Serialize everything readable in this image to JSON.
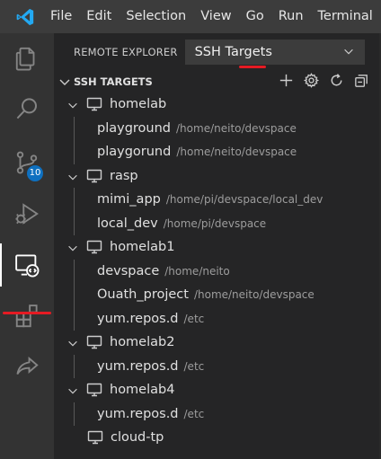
{
  "menubar": {
    "items": [
      "File",
      "Edit",
      "Selection",
      "View",
      "Go",
      "Run",
      "Terminal"
    ]
  },
  "activitybar": {
    "items": [
      {
        "name": "explorer-icon"
      },
      {
        "name": "search-icon"
      },
      {
        "name": "source-control-icon",
        "badge": "10"
      },
      {
        "name": "run-debug-icon"
      },
      {
        "name": "remote-explorer-icon",
        "active": true
      },
      {
        "name": "extensions-icon"
      },
      {
        "name": "live-share-icon"
      }
    ]
  },
  "explorer": {
    "title": "REMOTE EXPLORER",
    "dropdown_value": "SSH Targets"
  },
  "section": {
    "title": "SSH TARGETS"
  },
  "hosts": [
    {
      "label": "homelab",
      "expanded": true,
      "folders": [
        {
          "name": "playground",
          "path": "/home/neito/devspace"
        },
        {
          "name": "playgorund",
          "path": "/home/neito/devspace"
        }
      ]
    },
    {
      "label": "rasp",
      "expanded": true,
      "folders": [
        {
          "name": "mimi_app",
          "path": "/home/pi/devspace/local_dev"
        },
        {
          "name": "local_dev",
          "path": "/home/pi/devspace"
        }
      ]
    },
    {
      "label": "homelab1",
      "expanded": true,
      "folders": [
        {
          "name": "devspace",
          "path": "/home/neito"
        },
        {
          "name": "Ouath_project",
          "path": "/home/neito/devspace"
        },
        {
          "name": "yum.repos.d",
          "path": "/etc"
        }
      ]
    },
    {
      "label": "homelab2",
      "expanded": true,
      "folders": [
        {
          "name": "yum.repos.d",
          "path": "/etc"
        }
      ]
    },
    {
      "label": "homelab4",
      "expanded": true,
      "folders": [
        {
          "name": "yum.repos.d",
          "path": "/etc"
        }
      ]
    },
    {
      "label": "cloud-tp",
      "expanded": false,
      "folders": []
    }
  ],
  "colors": {
    "accent": "#0e70c0",
    "highlight": "#e51b23",
    "vscode_blue": "#23a9f2"
  }
}
